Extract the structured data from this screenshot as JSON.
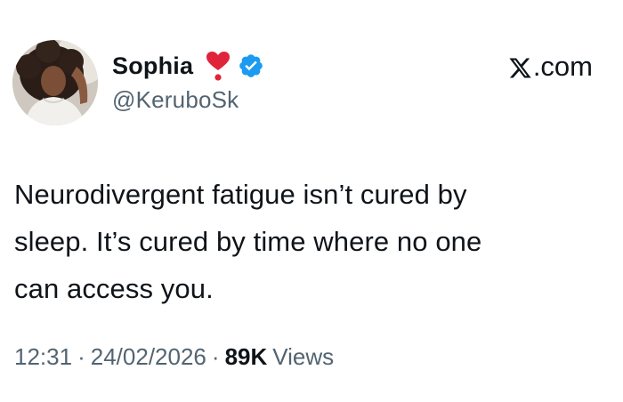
{
  "author": {
    "display_name": "Sophia",
    "handle": "@KeruboSk",
    "badge_icons": [
      "heart-exclamation-icon",
      "verified-badge-icon"
    ],
    "verified_color": "#1d9bf0",
    "heart_color": "#e0243a"
  },
  "site": {
    "label": ".com",
    "logo_icon": "x-logo-icon"
  },
  "tweet": {
    "text": "Neurodivergent fatigue isn’t cured by\nsleep. It’s cured by time where no one\ncan access you."
  },
  "meta": {
    "time": "12:31",
    "separator": "·",
    "date": "24/02/2026",
    "views_count": "89K",
    "views_label": "Views"
  }
}
